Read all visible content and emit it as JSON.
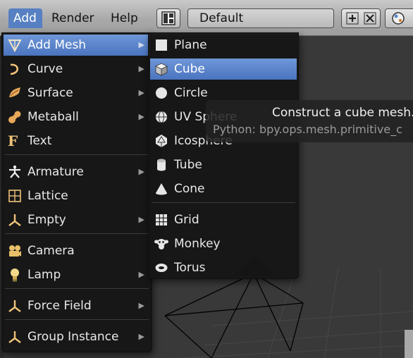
{
  "header": {
    "menus": [
      "Add",
      "Render",
      "Help"
    ],
    "layout_name": "Default"
  },
  "add_menu": {
    "items": [
      {
        "label": "Add Mesh",
        "icon": "mesh-icon",
        "submenu": true,
        "highlighted": true
      },
      {
        "label": "Curve",
        "icon": "curve-icon",
        "submenu": true
      },
      {
        "label": "Surface",
        "icon": "surface-icon",
        "submenu": true
      },
      {
        "label": "Metaball",
        "icon": "metaball-icon",
        "submenu": true
      },
      {
        "label": "Text",
        "icon": "text-icon",
        "submenu": false
      },
      {
        "label": "Armature",
        "icon": "armature-icon",
        "submenu": true
      },
      {
        "label": "Lattice",
        "icon": "lattice-icon",
        "submenu": false
      },
      {
        "label": "Empty",
        "icon": "empty-icon",
        "submenu": true
      },
      {
        "label": "Camera",
        "icon": "camera-icon",
        "submenu": false
      },
      {
        "label": "Lamp",
        "icon": "lamp-icon",
        "submenu": true
      },
      {
        "label": "Force Field",
        "icon": "force-field-icon",
        "submenu": true
      },
      {
        "label": "Group Instance",
        "icon": "group-instance-icon",
        "submenu": true
      }
    ]
  },
  "mesh_menu": {
    "items": [
      {
        "label": "Plane",
        "icon": "plane-icon"
      },
      {
        "label": "Cube",
        "icon": "cube-icon",
        "highlighted": true
      },
      {
        "label": "Circle",
        "icon": "circle-icon"
      },
      {
        "label": "UV Sphere",
        "icon": "uv-sphere-icon"
      },
      {
        "label": "Icosphere",
        "icon": "icosphere-icon"
      },
      {
        "label": "Tube",
        "icon": "tube-icon"
      },
      {
        "label": "Cone",
        "icon": "cone-icon"
      },
      {
        "label": "Grid",
        "icon": "grid-icon"
      },
      {
        "label": "Monkey",
        "icon": "monkey-icon"
      },
      {
        "label": "Torus",
        "icon": "torus-icon"
      }
    ]
  },
  "tooltip": {
    "title": "Construct a cube mesh.",
    "python": "Python: bpy.ops.mesh.primitive_c"
  },
  "colors": {
    "highlight": "#5680c2",
    "menu_bg": "#161616",
    "menu_text": "#e8e8e8"
  }
}
